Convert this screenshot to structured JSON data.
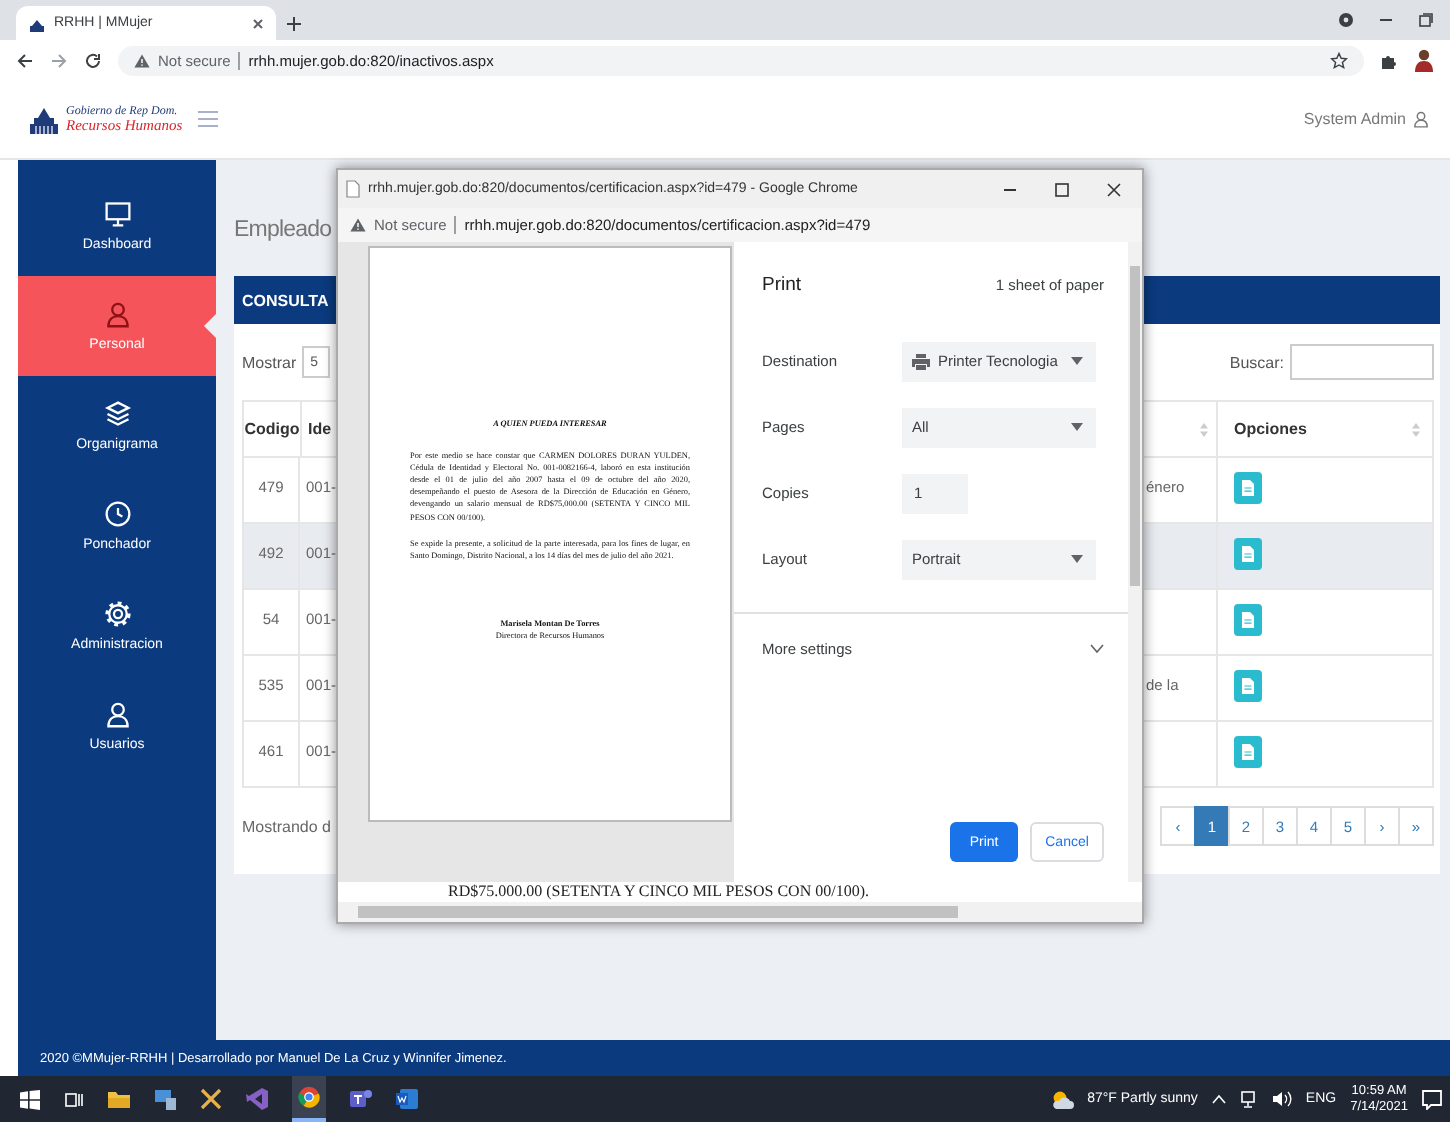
{
  "browser": {
    "tabs": [
      {
        "title": "RRHH | MMujer",
        "selected": true
      }
    ],
    "security_label": "Not secure",
    "url": "rrhh.mujer.gob.do:820/inactivos.aspx"
  },
  "header": {
    "logo_line_1": "Gobierno de Rep Dom.",
    "logo_line_2": "Recursos Humanos",
    "user": "System Admin"
  },
  "sidebar": {
    "items": [
      {
        "label": "Dashboard",
        "selected": false
      },
      {
        "label": "Personal",
        "selected": true
      },
      {
        "label": "Organigrama",
        "selected": false
      },
      {
        "label": "Ponchador",
        "selected": false
      },
      {
        "label": "Administracion",
        "selected": false
      },
      {
        "label": "Usuarios",
        "selected": false
      }
    ]
  },
  "page": {
    "title": "Empleado",
    "card_title": "CONSULTA",
    "length_label": "Mostrar",
    "length_value": "5",
    "search_label": "Buscar:",
    "columns": [
      "Codigo",
      "Ide",
      "Opciones"
    ],
    "rows": [
      {
        "codigo": "479",
        "column_2": "001-",
        "column_3": "énero",
        "highlighted": false
      },
      {
        "codigo": "492",
        "column_2": "001-",
        "highlighted": true
      },
      {
        "codigo": "54",
        "column_2": "001-",
        "highlighted": false
      },
      {
        "codigo": "535",
        "column_2": "001-",
        "column_3": "de la",
        "highlighted": false
      },
      {
        "codigo": "461",
        "column_2": "001-",
        "highlighted": false
      }
    ],
    "info": "Mostrando d",
    "pagination": [
      {
        "label": "‹",
        "selected": false
      },
      {
        "label": "1",
        "selected": true
      },
      {
        "label": "2",
        "selected": false
      },
      {
        "label": "3",
        "selected": false
      },
      {
        "label": "4",
        "selected": false
      },
      {
        "label": "5",
        "selected": false
      },
      {
        "label": "›",
        "selected": false
      },
      {
        "label": "»",
        "selected": false
      }
    ]
  },
  "popup": {
    "title": "rrhh.mujer.gob.do:820/documentos/certificacion.aspx?id=479 - Google Chrome",
    "security_label": "Not secure",
    "url": "rrhh.mujer.gob.do:820/documentos/certificacion.aspx?id=479",
    "document": {
      "heading": "A QUIEN PUEDA INTERESAR",
      "paragraphs": [
        "Por este medio se hace constar que CARMEN DOLORES DURAN YULDEN, Cédula de Identidad y Electoral No. 001-0082166-4, laboró en esta institución desde el 01 de julio del año 2007 hasta el 09 de octubre del año 2020, desempeñando el puesto de Asesora de la Dirección de Educación en Género, devengando un salario mensual de RD$75,000.00 (SETENTA Y CINCO MIL PESOS CON 00/100).",
        "Se expide la presente, a solicitud de la parte interesada, para los fines de lugar, en Santo Domingo, Distrito Nacional, a los 14 días del mes de julio del año 2021."
      ],
      "signature_name": "Marisela Montan De Torres",
      "signature_title": "Directora de Recursos Humanos"
    },
    "background_text": "RD$75.000.00 (SETENTA Y CINCO MIL PESOS CON 00/100).",
    "print": {
      "title": "Print",
      "sheets": "1 sheet of paper",
      "settings": [
        {
          "label": "Destination",
          "value": "Printer Tecnologia",
          "kind": "printer-select"
        },
        {
          "label": "Pages",
          "value": "All",
          "kind": "select"
        },
        {
          "label": "Copies",
          "value": "1",
          "kind": "number"
        },
        {
          "label": "Layout",
          "value": "Portrait",
          "kind": "select"
        }
      ],
      "more_settings": "More settings",
      "expanded": false,
      "print_button": "Print",
      "cancel_button": "Cancel"
    }
  },
  "footer": "2020 ©MMujer-RRHH | Desarrollado por Manuel De La Cruz y Winnifer Jimenez.",
  "taskbar": {
    "weather": "87°F  Partly sunny",
    "language": "ENG",
    "time": "10:59 AM",
    "date": "7/14/2021"
  }
}
